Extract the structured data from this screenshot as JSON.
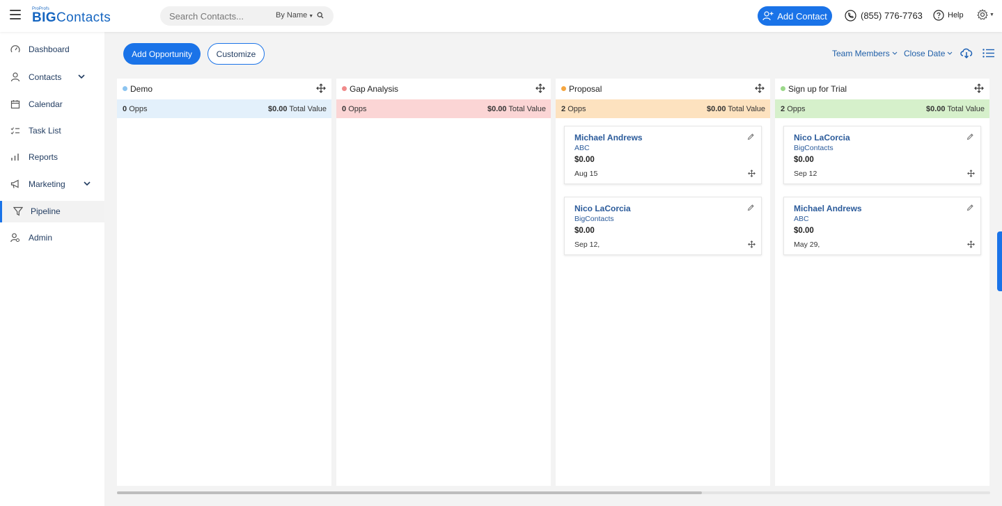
{
  "header": {
    "logo_pre": "ProProfs",
    "logo_bold": "BIG",
    "logo_thin": "Contacts",
    "search_placeholder": "Search Contacts...",
    "search_mode": "By Name",
    "add_contact_label": "Add Contact",
    "phone": "(855) 776-7763",
    "help_label": "Help"
  },
  "sidebar": {
    "items": [
      {
        "label": "Dashboard",
        "icon": "dashboard-icon"
      },
      {
        "label": "Contacts",
        "icon": "contacts-icon",
        "expandable": true
      },
      {
        "label": "Calendar",
        "icon": "calendar-icon"
      },
      {
        "label": "Task List",
        "icon": "task-list-icon"
      },
      {
        "label": "Reports",
        "icon": "reports-icon"
      },
      {
        "label": "Marketing",
        "icon": "marketing-icon",
        "expandable": true
      },
      {
        "label": "Pipeline",
        "icon": "pipeline-icon",
        "active": true
      },
      {
        "label": "Admin",
        "icon": "admin-icon"
      }
    ]
  },
  "toolbar": {
    "add_opportunity_label": "Add Opportunity",
    "customize_label": "Customize",
    "team_members_label": "Team Members",
    "close_date_label": "Close Date"
  },
  "pipeline": {
    "total_value_label": "Total Value",
    "opps_label": "Opps",
    "stages": [
      {
        "title": "Demo",
        "dot_color": "#8cc4f0",
        "band_color": "#e3f0fb",
        "opps_count": "0",
        "total_value": "$0.00",
        "cards": []
      },
      {
        "title": "Gap Analysis",
        "dot_color": "#f08a8a",
        "band_color": "#fbd5d5",
        "opps_count": "0",
        "total_value": "$0.00",
        "cards": []
      },
      {
        "title": "Proposal",
        "dot_color": "#f5a640",
        "band_color": "#fde2bf",
        "opps_count": "2",
        "total_value": "$0.00",
        "cards": [
          {
            "name": "Michael Andrews",
            "company": "ABC",
            "amount": "$0.00",
            "date": "Aug 15"
          },
          {
            "name": "Nico LaCorcia",
            "company": "BigContacts",
            "amount": "$0.00",
            "date": "Sep 12,"
          }
        ]
      },
      {
        "title": "Sign up for Trial",
        "dot_color": "#9bd88a",
        "band_color": "#d6f0cb",
        "opps_count": "2",
        "total_value": "$0.00",
        "cards": [
          {
            "name": "Nico LaCorcia",
            "company": "BigContacts",
            "amount": "$0.00",
            "date": "Sep 12"
          },
          {
            "name": "Michael Andrews",
            "company": "ABC",
            "amount": "$0.00",
            "date": "May 29,"
          }
        ]
      }
    ]
  },
  "colors": {
    "accent": "#1a73e8",
    "link": "#2a5a9a"
  }
}
